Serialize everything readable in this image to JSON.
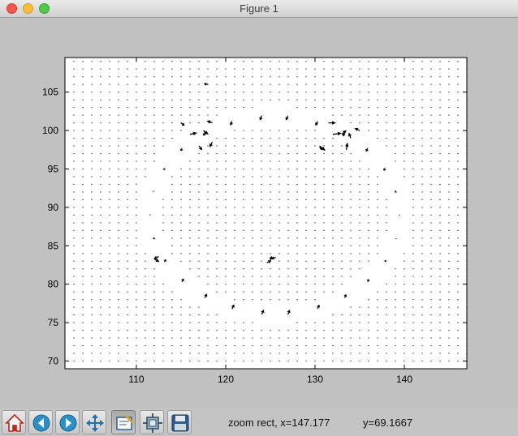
{
  "window": {
    "title": "Figure 1"
  },
  "toolbar": {
    "buttons": [
      {
        "name": "home-button",
        "icon": "home-icon"
      },
      {
        "name": "back-button",
        "icon": "back-arrow-icon"
      },
      {
        "name": "forward-button",
        "icon": "forward-arrow-icon"
      },
      {
        "name": "pan-button",
        "icon": "pan-move-icon"
      },
      {
        "name": "zoom-button",
        "icon": "zoom-rect-icon",
        "active": true
      },
      {
        "name": "subplots-button",
        "icon": "subplots-configure-icon"
      },
      {
        "name": "save-button",
        "icon": "save-disk-icon"
      }
    ]
  },
  "status": {
    "mode": "zoom rect, x=147.177",
    "y_readout": "y=69.1667"
  },
  "chart_data": {
    "type": "quiver",
    "title": "",
    "xlabel": "",
    "ylabel": "",
    "xlim": [
      102,
      147
    ],
    "ylim": [
      69,
      109.5
    ],
    "xticks": [
      110,
      120,
      130,
      140
    ],
    "yticks": [
      70,
      75,
      80,
      85,
      90,
      95,
      100,
      105
    ],
    "xtick_labels": [
      "110",
      "120",
      "130",
      "140"
    ],
    "ytick_labels": [
      "70",
      "75",
      "80",
      "85",
      "90",
      "95",
      "100",
      "105"
    ],
    "grid": false,
    "grid_points": {
      "x_start": 103,
      "x_step": 1,
      "y_start": 70,
      "y_step": 1
    },
    "arrow_color": "#000000",
    "ring": {
      "center": [
        125.5,
        89
      ],
      "radius_x": 14,
      "radius_y": 13,
      "angles_deg": [
        0,
        14,
        28,
        42,
        56,
        70,
        84,
        96,
        110,
        124,
        138,
        152,
        166,
        180,
        194,
        208,
        222,
        236,
        250,
        264,
        276,
        290,
        304,
        318,
        332,
        346
      ]
    },
    "vectors": [
      {
        "x": 118,
        "y": 106,
        "u": -1.0,
        "v": 0.15
      },
      {
        "x": 116,
        "y": 99.5,
        "u": 1.8,
        "v": 0.4
      },
      {
        "x": 117.5,
        "y": 100,
        "u": 1.3,
        "v": -1.0
      },
      {
        "x": 118.5,
        "y": 101,
        "u": -1.4,
        "v": 0.5
      },
      {
        "x": 117,
        "y": 98,
        "u": 0.8,
        "v": -1.1
      },
      {
        "x": 118.5,
        "y": 98.5,
        "u": -0.7,
        "v": -1.3
      },
      {
        "x": 115,
        "y": 101,
        "u": 0.9,
        "v": -0.7
      },
      {
        "x": 131.5,
        "y": 101,
        "u": 1.9,
        "v": 0
      },
      {
        "x": 132,
        "y": 99.5,
        "u": 2.2,
        "v": 0.3
      },
      {
        "x": 133,
        "y": 99.5,
        "u": 1.2,
        "v": 1.1
      },
      {
        "x": 134,
        "y": 99,
        "u": -0.5,
        "v": 1.4
      },
      {
        "x": 135,
        "y": 100,
        "u": -1.3,
        "v": 0.6
      },
      {
        "x": 130.5,
        "y": 98,
        "u": 1.5,
        "v": -1.2
      },
      {
        "x": 131,
        "y": 97.5,
        "u": -1.2,
        "v": 0.6
      },
      {
        "x": 133.5,
        "y": 97.5,
        "u": 0.3,
        "v": 1.8
      },
      {
        "x": 112,
        "y": 83.3,
        "u": 1.3,
        "v": -0.8
      },
      {
        "x": 112.5,
        "y": 83.6,
        "u": -1.3,
        "v": -0.6
      },
      {
        "x": 125,
        "y": 83,
        "u": 0.3,
        "v": 1.3
      },
      {
        "x": 125.6,
        "y": 83.5,
        "u": -1.2,
        "v": -0.4
      },
      {
        "x": 124.6,
        "y": 82.8,
        "u": 1.1,
        "v": 0.5
      }
    ]
  }
}
